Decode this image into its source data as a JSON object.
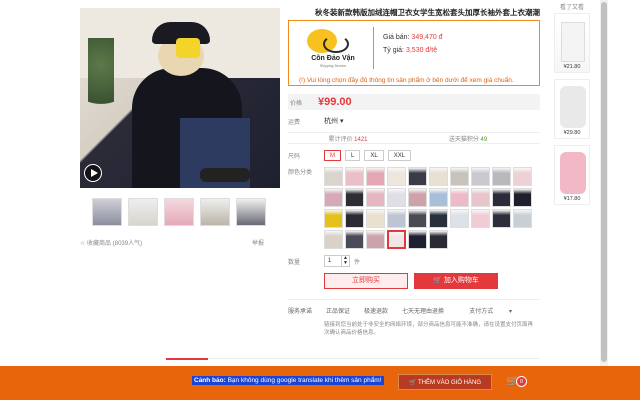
{
  "product": {
    "title": "秋冬装新款韩版加绒连帽卫衣女学生宽松套头加厚长袖外套上衣潮潮",
    "price_label": "价格",
    "price": "¥99.00",
    "region_label": "运费",
    "region": "杭州",
    "monthly_sales_label": "累计评价",
    "monthly_sales": "1421",
    "points_label": "送天猫积分",
    "points": "49",
    "size_label": "尺码",
    "sizes": [
      "M",
      "L",
      "XL",
      "XXL"
    ],
    "color_label": "颜色分类",
    "qty_label": "数量",
    "qty_value": "1",
    "qty_unit": "件",
    "buy_now": "立即购买",
    "add_to_cart": "加入购物车",
    "services_label": "服务承诺",
    "services": [
      "正品保证",
      "极速退款",
      "七天无理由退换"
    ],
    "payment_label": "支付方式",
    "desc": "链接到您当前处于非安全的网络环境，部分商品信息可能不准确，请在设置支付页面再次确认商品价格信息。",
    "favorite": "收藏商品",
    "favorite_count": "(8039人气)",
    "report": "举报"
  },
  "vendor": {
    "logo_name": "Côn Đảo Vận",
    "logo_sub": "Shipping Service",
    "price_vnd_label": "Giá bán:",
    "price_vnd": "349,470 đ",
    "rate_label": "Tỷ giá:",
    "rate": "3,530 đ/tệ",
    "notice": "(!) Vui lòng chọn đầy đủ thông tin sản phẩm ở bên dưới để xem giá chuẩn."
  },
  "sidebar": {
    "title": "看了又看",
    "items": [
      {
        "price": "¥21.80"
      },
      {
        "price": "¥29.80"
      },
      {
        "price": "¥17.80"
      }
    ]
  },
  "footer": {
    "warning_bold": "Cảnh báo:",
    "warning": " Bạn không dùng google translate khi thêm sản phẩm!",
    "add_cart": "THÊM VÀO GIỎ HÀNG",
    "cart_count": "0"
  },
  "colors": {
    "accent": "#e4393c",
    "footer_bg": "#e8650c",
    "warn_bg": "#1b44d4"
  },
  "swatches": [
    "#d9d4cc",
    "#e9c0c7",
    "#e5a6b6",
    "#ede6dc",
    "#3b3b48",
    "#e8e0d2",
    "#c7c2bb",
    "#c9c9cf",
    "#b9b9bd",
    "#edd1d5",
    "#d7a9b7",
    "#2d2d36",
    "#e4b7c1",
    "#dfdfe6",
    "#cfa2a9",
    "#a8bfd8",
    "#efbac7",
    "#e7c5cb",
    "#2a2c3a",
    "#1e1f2a",
    "#e4c21b",
    "#2b2b33",
    "#e9e0cf",
    "#bcc5d1",
    "#4b4b55",
    "#28303d",
    "#dde1e8",
    "#f0cdd4",
    "#2c2f3b",
    "#c8d0d6",
    "#d8d2c8",
    "#4a4a58",
    "#caa3ac",
    "#f1e6e6",
    "#1f2030",
    "#2a2a34"
  ]
}
